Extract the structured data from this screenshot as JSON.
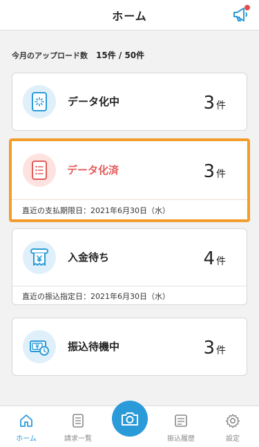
{
  "header": {
    "title": "ホーム",
    "notice_icon": "megaphone-icon"
  },
  "upload": {
    "label": "今月のアップロード数",
    "value": "15件 / 50件"
  },
  "cards": [
    {
      "id": "processing",
      "title": "データ化中",
      "count": "3",
      "unit": "件",
      "icon": "loading-document-icon"
    },
    {
      "id": "completed",
      "title": "データ化済",
      "count": "3",
      "unit": "件",
      "footer": "直近の支払期限日：2021年6月30日（水）",
      "icon": "list-document-icon"
    },
    {
      "id": "awaiting",
      "title": "入金待ち",
      "count": "4",
      "unit": "件",
      "footer": "直近の振込指定日：2021年6月30日（水）",
      "icon": "yen-receipt-icon"
    },
    {
      "id": "transfer",
      "title": "振込待機中",
      "count": "3",
      "unit": "件",
      "icon": "yen-clock-icon"
    }
  ],
  "nav": [
    {
      "label": "ホーム",
      "icon": "home-icon",
      "active": true
    },
    {
      "label": "請求一覧",
      "icon": "invoice-list-icon"
    },
    {
      "label": "",
      "icon": "camera-icon"
    },
    {
      "label": "振込履歴",
      "icon": "transfer-history-icon"
    },
    {
      "label": "設定",
      "icon": "gear-icon"
    }
  ],
  "colors": {
    "accent": "#2a9ad8",
    "highlight_border": "#f39c2a",
    "completed_text": "#e45b5b",
    "badge_red": "#e94a4a"
  }
}
